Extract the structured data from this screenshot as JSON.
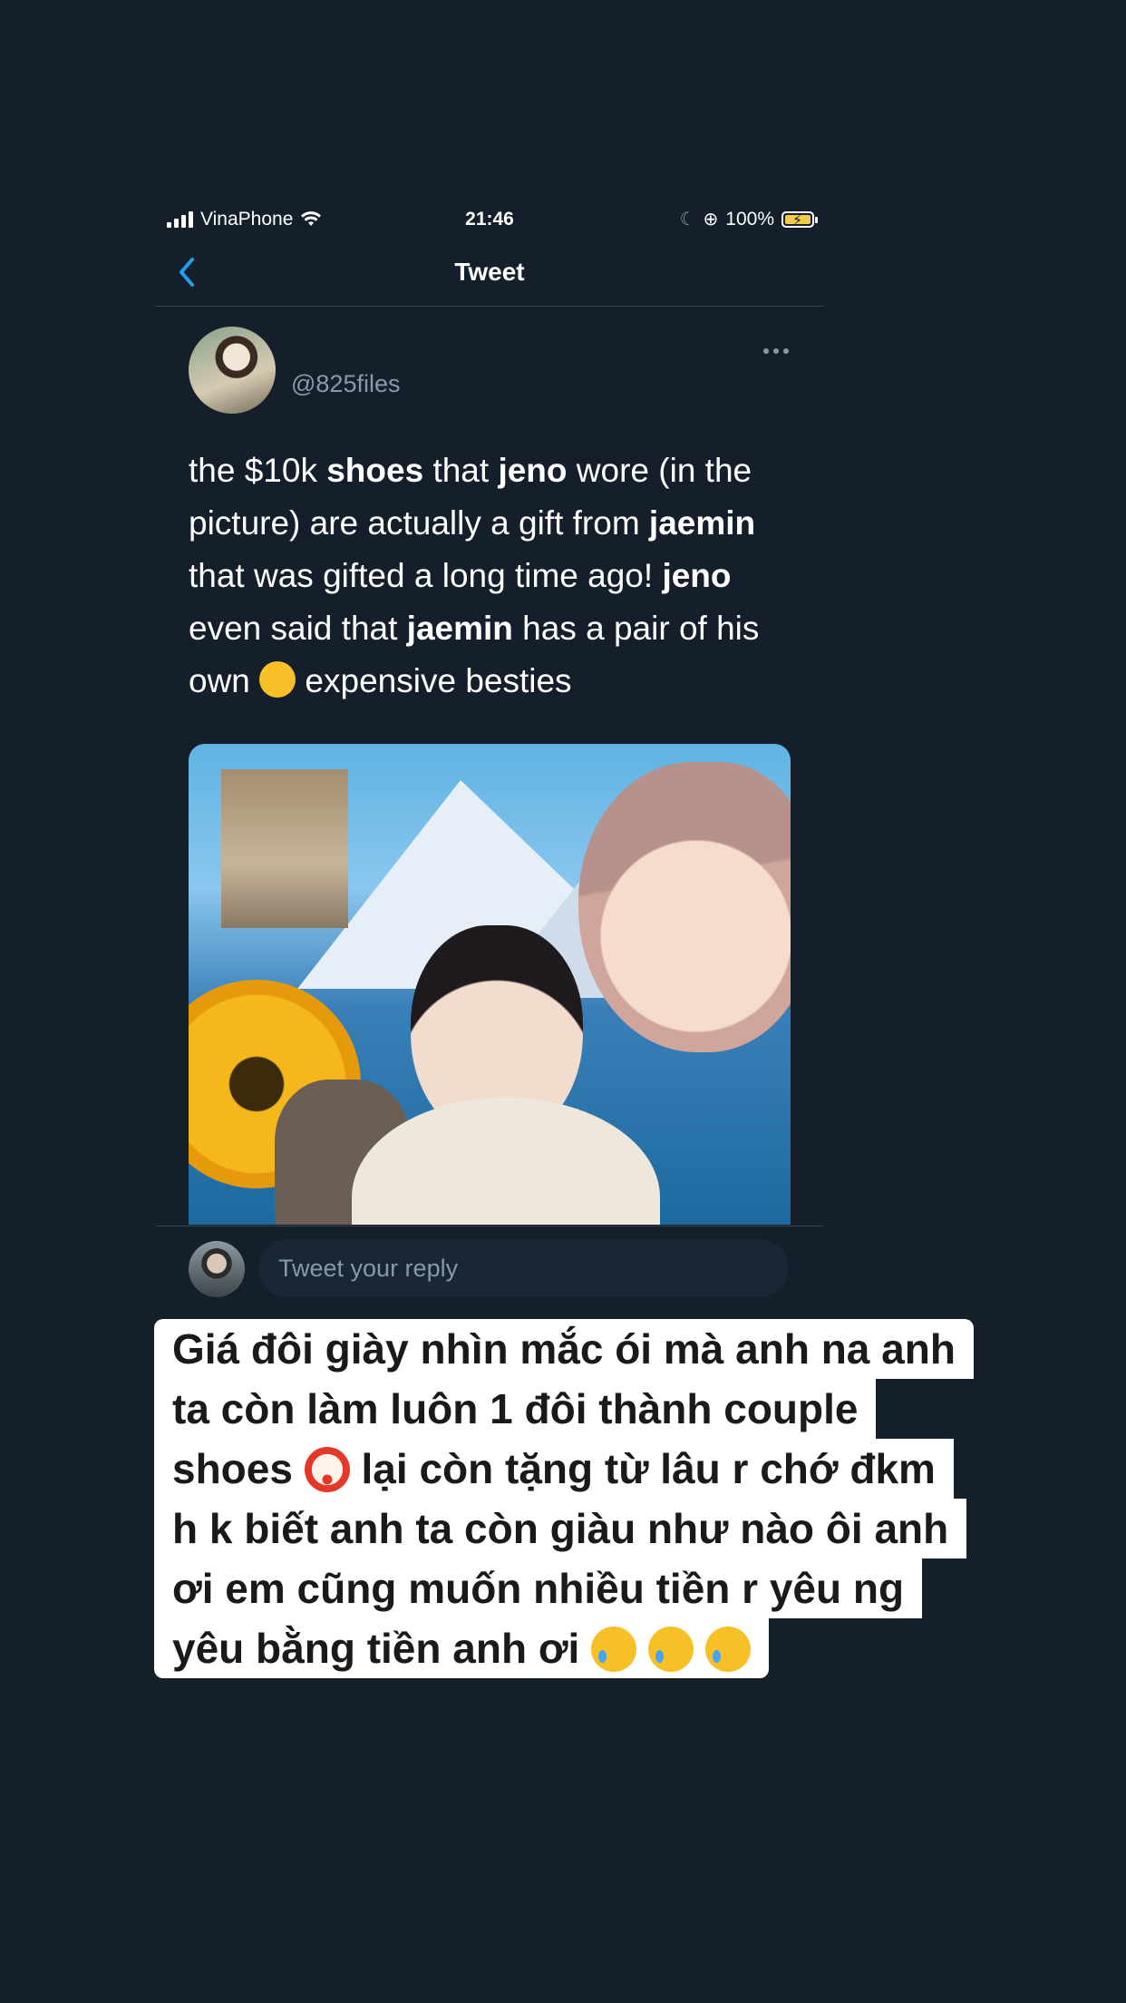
{
  "status_bar": {
    "carrier": "VinaPhone",
    "time": "21:46",
    "battery": "100%"
  },
  "nav": {
    "title": "Tweet"
  },
  "tweet": {
    "handle": "@825files",
    "text_segments": [
      {
        "t": "the $10k ",
        "b": false
      },
      {
        "t": "shoes",
        "b": true
      },
      {
        "t": " that ",
        "b": false
      },
      {
        "t": "jeno",
        "b": true
      },
      {
        "t": " wore (in the picture) are actually a gift from ",
        "b": false
      },
      {
        "t": "jaemin",
        "b": true
      },
      {
        "t": " that was gifted a long time ago! ",
        "b": false
      },
      {
        "t": "jeno",
        "b": true
      },
      {
        "t": " even said that ",
        "b": false
      },
      {
        "t": "jaemin",
        "b": true
      },
      {
        "t": " has a pair of his own ",
        "b": false
      },
      {
        "t": " expensive besties",
        "b": false
      }
    ]
  },
  "reply": {
    "placeholder": "Tweet your reply"
  },
  "caption": {
    "lines": [
      "Giá đôi giày nhìn mắc ói mà anh na anh",
      "ta còn làm luôn 1 đôi thành couple",
      "shoes",
      "lại còn tặng từ lâu r chớ đkm",
      "h k biết anh ta còn giàu như nào ôi anh",
      "ơi em cũng muốn nhiều tiền r yêu ng",
      "yêu bằng tiền anh ơi"
    ]
  },
  "colors": {
    "background": "#16202a",
    "accent": "#1da1f2",
    "muted": "#8899a6"
  }
}
